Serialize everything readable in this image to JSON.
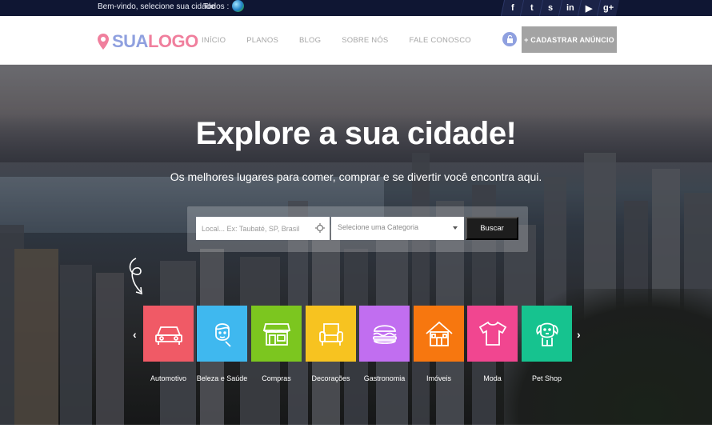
{
  "topbar": {
    "welcome": "Bem-vindo, selecione sua cidade",
    "todos": "Todos :",
    "social_icons": [
      "facebook-icon",
      "twitter-icon",
      "skype-icon",
      "linkedin-icon",
      "youtube-icon",
      "google-plus-icon"
    ],
    "social_glyphs": [
      "f",
      "t",
      "s",
      "in",
      "▶",
      "g+"
    ]
  },
  "header": {
    "logo_part1": "SUA",
    "logo_part2": "LOGO",
    "nav": [
      "INÍCIO",
      "PLANOS",
      "BLOG",
      "SOBRE NÓS",
      "FALE CONOSCO"
    ],
    "cta": "+ CADASTRAR ANÚNCIO"
  },
  "hero": {
    "title": "Explore a sua cidade!",
    "subtitle": "Os melhores lugares para comer, comprar e se divertir você encontra aqui.",
    "location_placeholder": "Local... Ex: Taubaté, SP, Brasil",
    "category_placeholder": "Selecione uma Categoria",
    "search_button": "Buscar"
  },
  "categories": [
    {
      "label": "Automotivo",
      "color": "#f05a66",
      "icon": "car-icon"
    },
    {
      "label": "Beleza e Saúde",
      "color": "#3fb8ef",
      "icon": "woman-face-icon"
    },
    {
      "label": "Compras",
      "color": "#7cc61f",
      "icon": "shop-icon"
    },
    {
      "label": "Decorações",
      "color": "#f7c320",
      "icon": "armchair-icon"
    },
    {
      "label": "Gastronomia",
      "color": "#c16ef0",
      "icon": "burger-icon"
    },
    {
      "label": "Imóveis",
      "color": "#f7770f",
      "icon": "house-icon"
    },
    {
      "label": "Moda",
      "color": "#f14690",
      "icon": "tshirt-icon"
    },
    {
      "label": "Pet Shop",
      "color": "#16c38f",
      "icon": "dog-icon"
    }
  ],
  "colors": {
    "topbar": "#0f1633",
    "logo_blue": "#8fa0df",
    "logo_pink": "#f07f9d",
    "cta": "#a3a3a3"
  }
}
